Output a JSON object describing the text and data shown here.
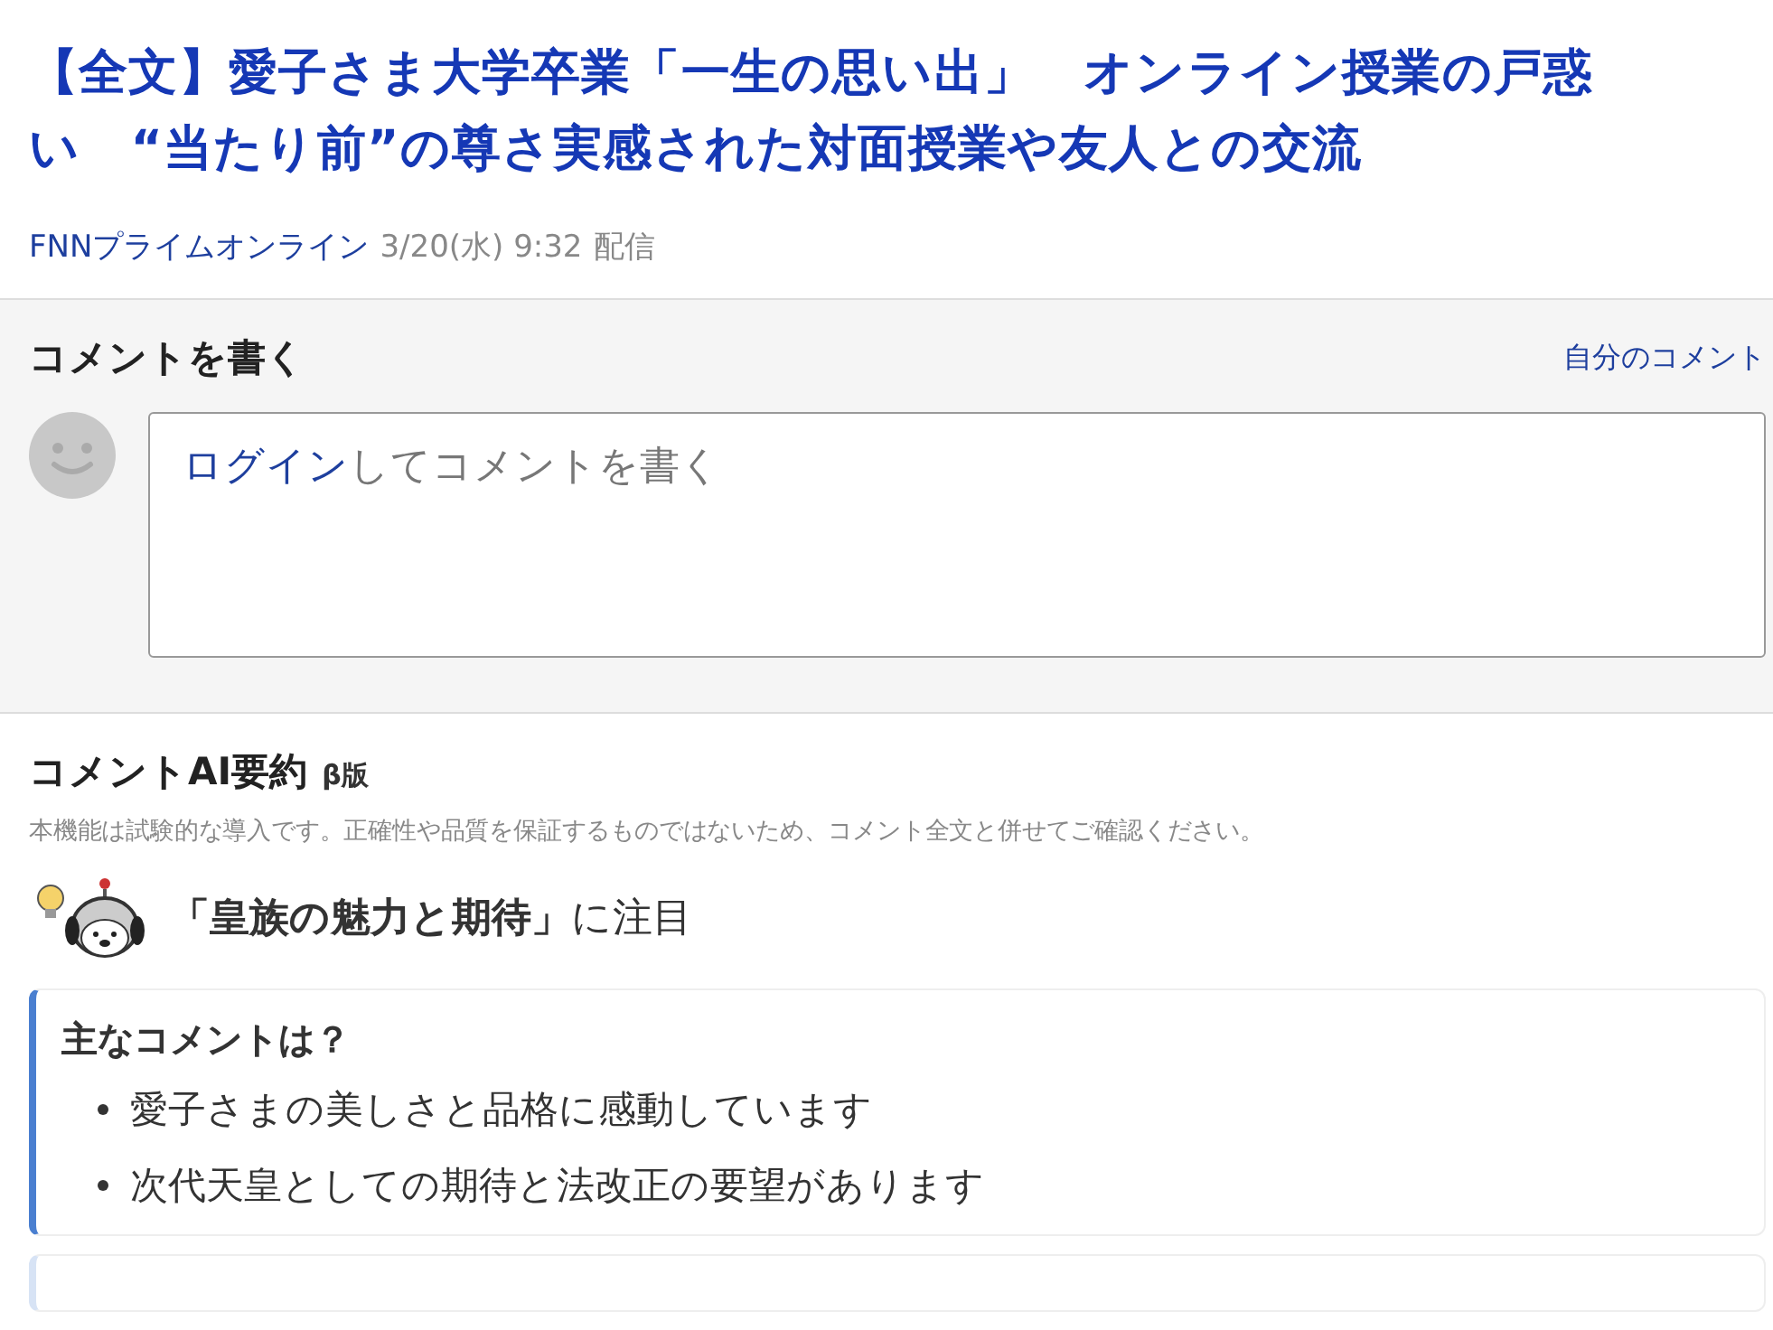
{
  "article": {
    "title": "【全文】愛子さま大学卒業「一生の思い出」　オンライン授業の戸惑い　“当たり前”の尊さ実感された対面授業や友人との交流",
    "source": "FNNプライムオンライン",
    "date": "3/20(水) 9:32",
    "label": "配信"
  },
  "comment_form": {
    "heading": "コメントを書く",
    "my_comments_link": "自分のコメント",
    "placeholder": {
      "link": "ログイン",
      "text": "してコメントを書く"
    }
  },
  "ai_summary": {
    "heading": "コメントAI要約",
    "badge": "β版",
    "disclaimer": "本機能は試験的な導入です。正確性や品質を保証するものではないため、コメント全文と併せてご確認ください。",
    "highlight": "**「皇族の魅力と期待」**に注目",
    "cards": [
      {
        "heading": "主なコメントは？",
        "items": [
          "愛子さまの美しさと品格に感動しています",
          "次代天皇としての期待と法改正の要望があります"
        ]
      }
    ]
  }
}
